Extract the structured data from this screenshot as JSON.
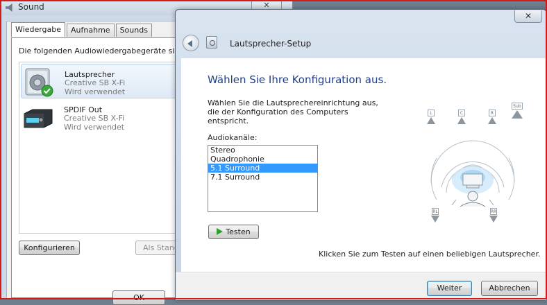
{
  "sound_window": {
    "title": "Sound",
    "close_glyph": "✕",
    "tabs": [
      {
        "label": "Wiedergabe",
        "active": true
      },
      {
        "label": "Aufnahme",
        "active": false
      },
      {
        "label": "Sounds",
        "active": false
      }
    ],
    "description": "Die folgenden Audiowiedergabegeräte sind",
    "devices": [
      {
        "name": "Lautsprecher",
        "driver": "Creative SB X-Fi",
        "status": "Wird verwendet",
        "icon": "speaker-icon",
        "default_check": true
      },
      {
        "name": "SPDIF Out",
        "driver": "Creative SB X-Fi",
        "status": "Wird verwendet",
        "icon": "spdif-device-icon",
        "default_check": false
      }
    ],
    "configure_label": "Konfigurieren",
    "set_default_label": "Als Stand",
    "ok_label": "OK"
  },
  "setup_window": {
    "title": "Lautsprecher-Setup",
    "close_glyph": "✕",
    "heading": "Wählen Sie Ihre Konfiguration aus.",
    "intro": "Wählen Sie die Lautsprechereinrichtung aus, die der Konfiguration des Computers entspricht.",
    "channels_label": "Audiokanäle:",
    "channels": [
      "Stereo",
      "Quadrophonie",
      "5.1 Surround",
      "7.1 Surround"
    ],
    "selected_channel": "5.1 Surround",
    "test_label": "Testen",
    "hint": "Klicken Sie zum Testen auf einen beliebigen Lautsprecher.",
    "next_label": "Weiter",
    "cancel_label": "Abbrechen",
    "speaker_labels": {
      "left": "L",
      "center": "C",
      "right": "R",
      "sub": "Sub",
      "rear_left": "RL",
      "rear_right": "RR"
    }
  },
  "colors": {
    "heading_blue": "#1e3e8c",
    "selection_blue": "#3399ff",
    "frame_red": "#d21c1c"
  }
}
